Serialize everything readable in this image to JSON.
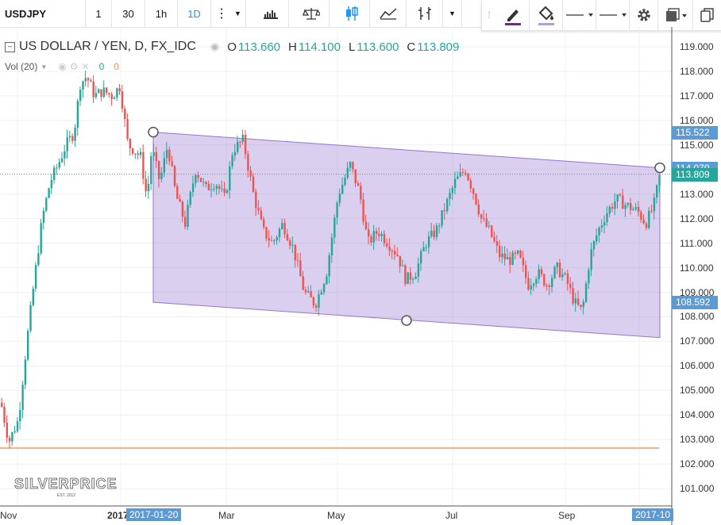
{
  "toolbar": {
    "symbol": "USDJPY",
    "intervals": [
      "1",
      "30",
      "1h",
      "1D"
    ],
    "active_interval": "1D"
  },
  "legend": {
    "title": "US DOLLAR / YEN, D, FX_IDC",
    "open_label": "O",
    "open": "113.660",
    "high_label": "H",
    "high": "114.100",
    "low_label": "L",
    "low": "113.600",
    "close_label": "C",
    "close": "113.809",
    "value_color": "#26a69a",
    "vol_label": "Vol (20)",
    "vol_values": [
      "0",
      "0"
    ]
  },
  "price_axis": {
    "ticks": [
      "119.000",
      "118.000",
      "117.000",
      "116.000",
      "115.000",
      "114.000",
      "113.000",
      "112.000",
      "111.000",
      "110.000",
      "109.000",
      "108.000",
      "107.000",
      "106.000",
      "105.000",
      "104.000",
      "103.000",
      "102.000",
      "101.000"
    ],
    "tags": [
      {
        "value": "115.522",
        "color": "#5b9bd5"
      },
      {
        "value": "114.070",
        "color": "#5b9bd5"
      },
      {
        "value": "113.809",
        "color": "#26a69a"
      },
      {
        "value": "108.592",
        "color": "#5b9bd5"
      }
    ]
  },
  "time_axis": {
    "labels": [
      "Nov",
      "2017",
      "2017-01-20",
      "Mar",
      "May",
      "Jul",
      "Sep",
      "2017-10"
    ],
    "highlighted": [
      "2017-01-20",
      "2017-10"
    ]
  },
  "logo": {
    "text": "SILVERPRICE",
    "sub": "EST. 2012"
  },
  "chart_data": {
    "type": "candlestick",
    "y_range": [
      100.5,
      119.5
    ],
    "up_color": "#26a69a",
    "down_color": "#ef5350",
    "channel_color": "#9575cd",
    "horizontal_line": {
      "value": 102.65,
      "color": "#f5b27a"
    },
    "last_price": 113.809
  }
}
